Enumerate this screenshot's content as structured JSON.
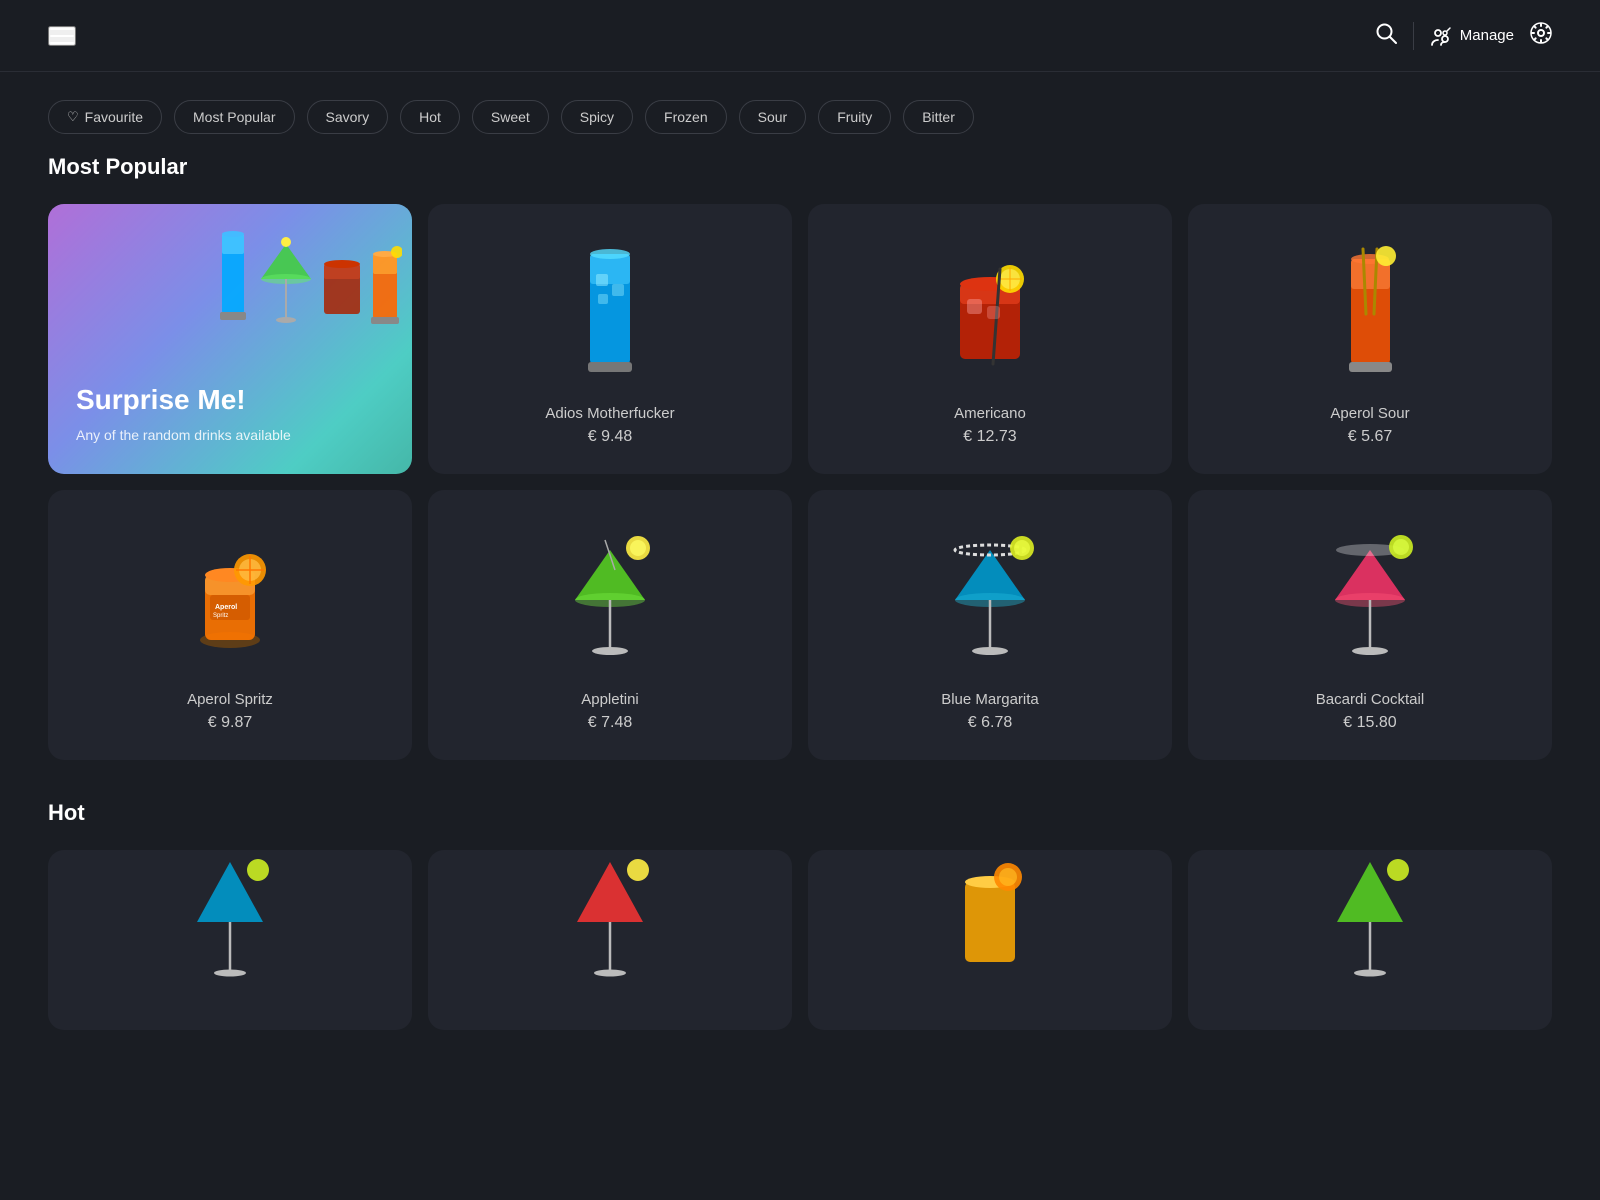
{
  "header": {
    "manage_label": "Manage"
  },
  "filters": [
    {
      "id": "favourite",
      "label": "Favourite",
      "has_heart": true
    },
    {
      "id": "most-popular",
      "label": "Most Popular",
      "has_heart": false
    },
    {
      "id": "savory",
      "label": "Savory",
      "has_heart": false
    },
    {
      "id": "hot",
      "label": "Hot",
      "has_heart": false
    },
    {
      "id": "sweet",
      "label": "Sweet",
      "has_heart": false
    },
    {
      "id": "spicy",
      "label": "Spicy",
      "has_heart": false
    },
    {
      "id": "frozen",
      "label": "Frozen",
      "has_heart": false
    },
    {
      "id": "sour",
      "label": "Sour",
      "has_heart": false
    },
    {
      "id": "fruity",
      "label": "Fruity",
      "has_heart": false
    },
    {
      "id": "bitter",
      "label": "Bitter",
      "has_heart": false
    }
  ],
  "sections": [
    {
      "id": "most-popular",
      "title": "Most Popular",
      "drinks": [
        {
          "id": "surprise",
          "type": "surprise",
          "title": "Surprise Me!",
          "subtitle": "Any of the random drinks available"
        },
        {
          "id": "adios-motherfucker",
          "name": "Adios Motherfucker",
          "price": "€ 9.48",
          "color": "#00aaff",
          "glass_type": "tall"
        },
        {
          "id": "americano",
          "name": "Americano",
          "price": "€ 12.73",
          "color": "#cc2200",
          "glass_type": "rocks"
        },
        {
          "id": "aperol-sour",
          "name": "Aperol Sour",
          "price": "€ 5.67",
          "color": "#ff6633",
          "glass_type": "tall"
        },
        {
          "id": "aperol-spritz",
          "name": "Aperol Spritz",
          "price": "€ 9.87",
          "color": "#ff8800",
          "glass_type": "rocks-orange"
        },
        {
          "id": "appletini",
          "name": "Appletini",
          "price": "€ 7.48",
          "color": "#66cc00",
          "glass_type": "martini"
        },
        {
          "id": "blue-margarita",
          "name": "Blue Margarita",
          "price": "€ 6.78",
          "color": "#00aacc",
          "glass_type": "martini-blue"
        },
        {
          "id": "bacardi-cocktail",
          "name": "Bacardi Cocktail",
          "price": "€ 15.80",
          "color": "#ee4477",
          "glass_type": "martini-red"
        }
      ]
    },
    {
      "id": "hot",
      "title": "Hot",
      "drinks": [
        {
          "id": "hot1",
          "color": "#00aacc",
          "glass_type": "martini-blue"
        },
        {
          "id": "hot2",
          "color": "#ee3333",
          "glass_type": "martini-red"
        },
        {
          "id": "hot3",
          "color": "#ffbb00",
          "glass_type": "rocks"
        },
        {
          "id": "hot4",
          "color": "#66cc00",
          "glass_type": "martini"
        }
      ]
    }
  ]
}
